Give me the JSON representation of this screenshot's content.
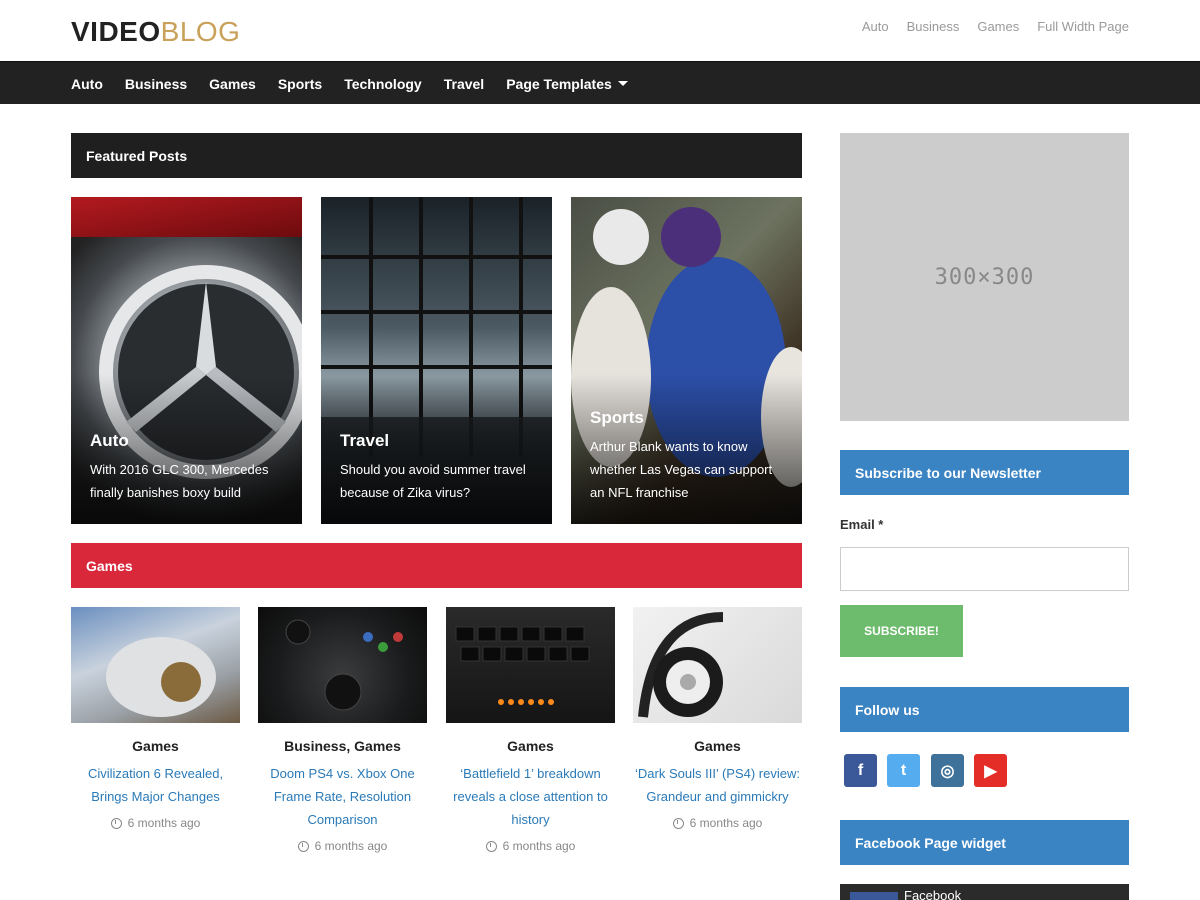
{
  "header": {
    "logo_bold": "VIDEO",
    "logo_light": "BLOG",
    "top_links": [
      "Auto",
      "Business",
      "Games",
      "Full Width Page"
    ]
  },
  "nav": {
    "items": [
      "Auto",
      "Business",
      "Games",
      "Sports",
      "Technology",
      "Travel"
    ],
    "dropdown": "Page Templates"
  },
  "featured": {
    "heading": "Featured Posts",
    "cards": [
      {
        "category": "Auto",
        "title": "With 2016 GLC 300, Mercedes finally banishes boxy build"
      },
      {
        "category": "Travel",
        "title": "Should you avoid summer travel because of Zika virus?"
      },
      {
        "category": "Sports",
        "title": "Arthur Blank wants to know whether Las Vegas can support an NFL franchise"
      }
    ]
  },
  "games": {
    "heading": "Games",
    "posts": [
      {
        "category": "Games",
        "title": "Civilization 6 Revealed, Brings Major Changes",
        "time": "6 months ago"
      },
      {
        "category": "Business, Games",
        "title": "Doom PS4 vs. Xbox One Frame Rate, Resolution Comparison",
        "time": "6 months ago"
      },
      {
        "category": "Games",
        "title": "‘Battlefield 1’ breakdown reveals a close attention to history",
        "time": "6 months ago"
      },
      {
        "category": "Games",
        "title": "‘Dark Souls III’ (PS4) review: Grandeur and gimmickry",
        "time": "6 months ago"
      }
    ]
  },
  "sidebar": {
    "ad_label": "300×300",
    "newsletter_heading": "Subscribe to our Newsletter",
    "email_label": "Email *",
    "subscribe_button": "SUBSCRIBE!",
    "follow_heading": "Follow us",
    "social": [
      {
        "name": "facebook-icon",
        "glyph": "f",
        "color": "#3b5998"
      },
      {
        "name": "twitter-icon",
        "glyph": "t",
        "color": "#55acee"
      },
      {
        "name": "instagram-icon",
        "glyph": "◎",
        "color": "#3f729b"
      },
      {
        "name": "youtube-icon",
        "glyph": "▶",
        "color": "#e52d27"
      }
    ],
    "fb_widget_heading": "Facebook Page widget",
    "fb_embed_text": "Facebook"
  },
  "colors": {
    "logo_accent": "#c9a15a",
    "nav_bg": "#222222",
    "games_accent": "#d8283a",
    "sidebar_accent": "#3b84c4",
    "subscribe_green": "#6dbb6d",
    "link_blue": "#2a7ab8"
  }
}
